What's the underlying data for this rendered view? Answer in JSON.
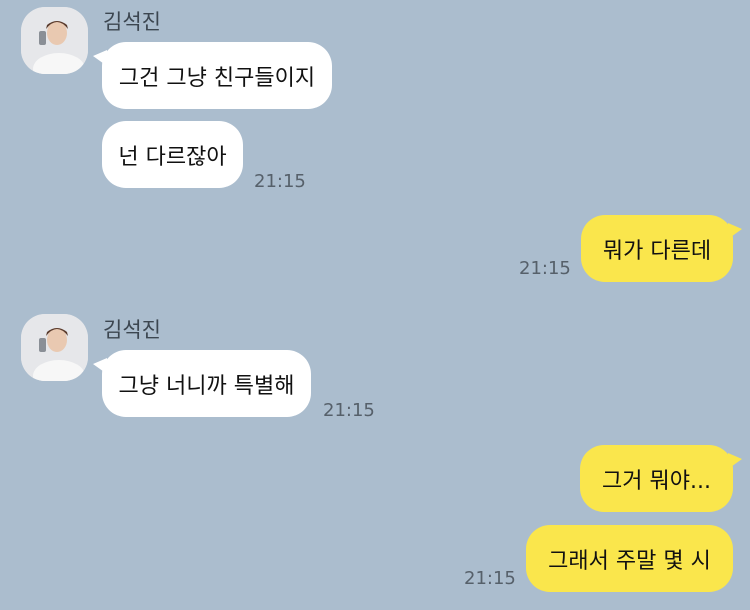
{
  "chat": {
    "groups": [
      {
        "sender": "김석진",
        "messages": [
          "그건 그냥 친구들이지",
          "넌 다르잖아"
        ],
        "time": "21:15"
      },
      {
        "messages": [
          "뭐가 다른데"
        ],
        "time": "21:15"
      },
      {
        "sender": "김석진",
        "messages": [
          "그냥 너니까 특별해"
        ],
        "time": "21:15"
      },
      {
        "messages": [
          "그거 뭐야...",
          "그래서 주말 몇 시"
        ],
        "time": "21:15"
      }
    ]
  },
  "colors": {
    "background": "#abbdce",
    "incoming_bubble": "#ffffff",
    "outgoing_bubble": "#fae64c",
    "timestamp": "#56606a"
  },
  "icons": {
    "avatar": "profile-photo"
  }
}
